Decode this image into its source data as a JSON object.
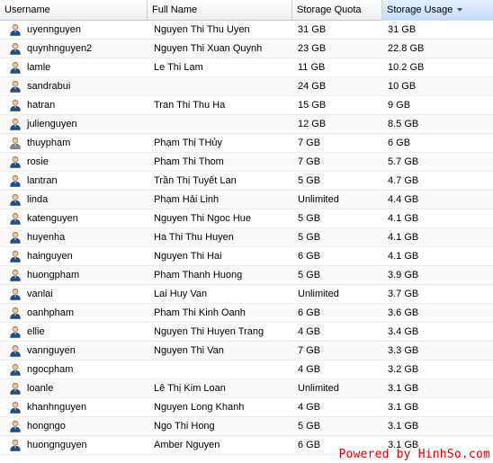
{
  "columns": {
    "username": "Username",
    "full_name": "Full Name",
    "quota": "Storage Quota",
    "usage": "Storage Usage"
  },
  "rows": [
    {
      "username": "uyennguyen",
      "full_name": "Nguyen Thi Thu Uyen",
      "quota": "31 GB",
      "usage": "31 GB"
    },
    {
      "username": "quynhnguyen2",
      "full_name": "Nguyen Thi Xuan Quynh",
      "quota": "23 GB",
      "usage": "22.8 GB"
    },
    {
      "username": "lamle",
      "full_name": "Le Thi Lam",
      "quota": "11 GB",
      "usage": "10.2 GB"
    },
    {
      "username": "sandrabui",
      "full_name": "",
      "quota": "24 GB",
      "usage": "10 GB"
    },
    {
      "username": "hatran",
      "full_name": "Tran Thi Thu Ha",
      "quota": "15 GB",
      "usage": "9 GB"
    },
    {
      "username": "julienguyen",
      "full_name": "",
      "quota": "12 GB",
      "usage": "8.5 GB"
    },
    {
      "username": "thuypham",
      "full_name": "Phạm Thị THủy",
      "quota": "7 GB",
      "usage": "6 GB",
      "icon": "gray"
    },
    {
      "username": "rosie",
      "full_name": "Pham Thi Thom",
      "quota": "7 GB",
      "usage": "5.7 GB"
    },
    {
      "username": "lantran",
      "full_name": "Trần Thị Tuyết Lan",
      "quota": "5 GB",
      "usage": "4.7 GB"
    },
    {
      "username": "linda",
      "full_name": "Phạm Hải Linh",
      "quota": "Unlimited",
      "usage": "4.4 GB"
    },
    {
      "username": "katenguyen",
      "full_name": "Nguyen Thi Ngoc Hue",
      "quota": "5 GB",
      "usage": "4.1 GB"
    },
    {
      "username": "huyenha",
      "full_name": "Ha Thi Thu Huyen",
      "quota": "5 GB",
      "usage": "4.1 GB"
    },
    {
      "username": "hainguyen",
      "full_name": "Nguyen Thi Hai",
      "quota": "6 GB",
      "usage": "4.1 GB"
    },
    {
      "username": "huongpham",
      "full_name": "Pham Thanh Huong",
      "quota": "5 GB",
      "usage": "3.9 GB"
    },
    {
      "username": "vanlai",
      "full_name": "Lai Huy Van",
      "quota": "Unlimited",
      "usage": "3.7 GB"
    },
    {
      "username": "oanhpham",
      "full_name": "Pham Thi Kinh Oanh",
      "quota": "6 GB",
      "usage": "3.6 GB"
    },
    {
      "username": "ellie",
      "full_name": "Nguyen Thi Huyen Trang",
      "quota": "4 GB",
      "usage": "3.4 GB"
    },
    {
      "username": "vannguyen",
      "full_name": "Nguyen Thi Van",
      "quota": "7 GB",
      "usage": "3.3 GB"
    },
    {
      "username": "ngocpham",
      "full_name": "",
      "quota": "4 GB",
      "usage": "3.2 GB"
    },
    {
      "username": "loanle",
      "full_name": "Lê Thị Kim Loan",
      "quota": "Unlimited",
      "usage": "3.1 GB"
    },
    {
      "username": "khanhnguyen",
      "full_name": "Nguyen Long Khanh",
      "quota": "4 GB",
      "usage": "3.1 GB"
    },
    {
      "username": "hongngo",
      "full_name": "Ngo Thi Hong",
      "quota": "5 GB",
      "usage": "3.1 GB"
    },
    {
      "username": "huongnguyen",
      "full_name": "Amber Nguyen",
      "quota": "6 GB",
      "usage": "3.1 GB"
    }
  ],
  "watermark": "Powered by HinhSo.com",
  "colors": {
    "icon_active": "#1f4e8c",
    "icon_inactive": "#8a8a8a",
    "watermark": "#e00000"
  },
  "icons": {
    "user": "user-icon",
    "sort": "sort-desc-icon"
  }
}
